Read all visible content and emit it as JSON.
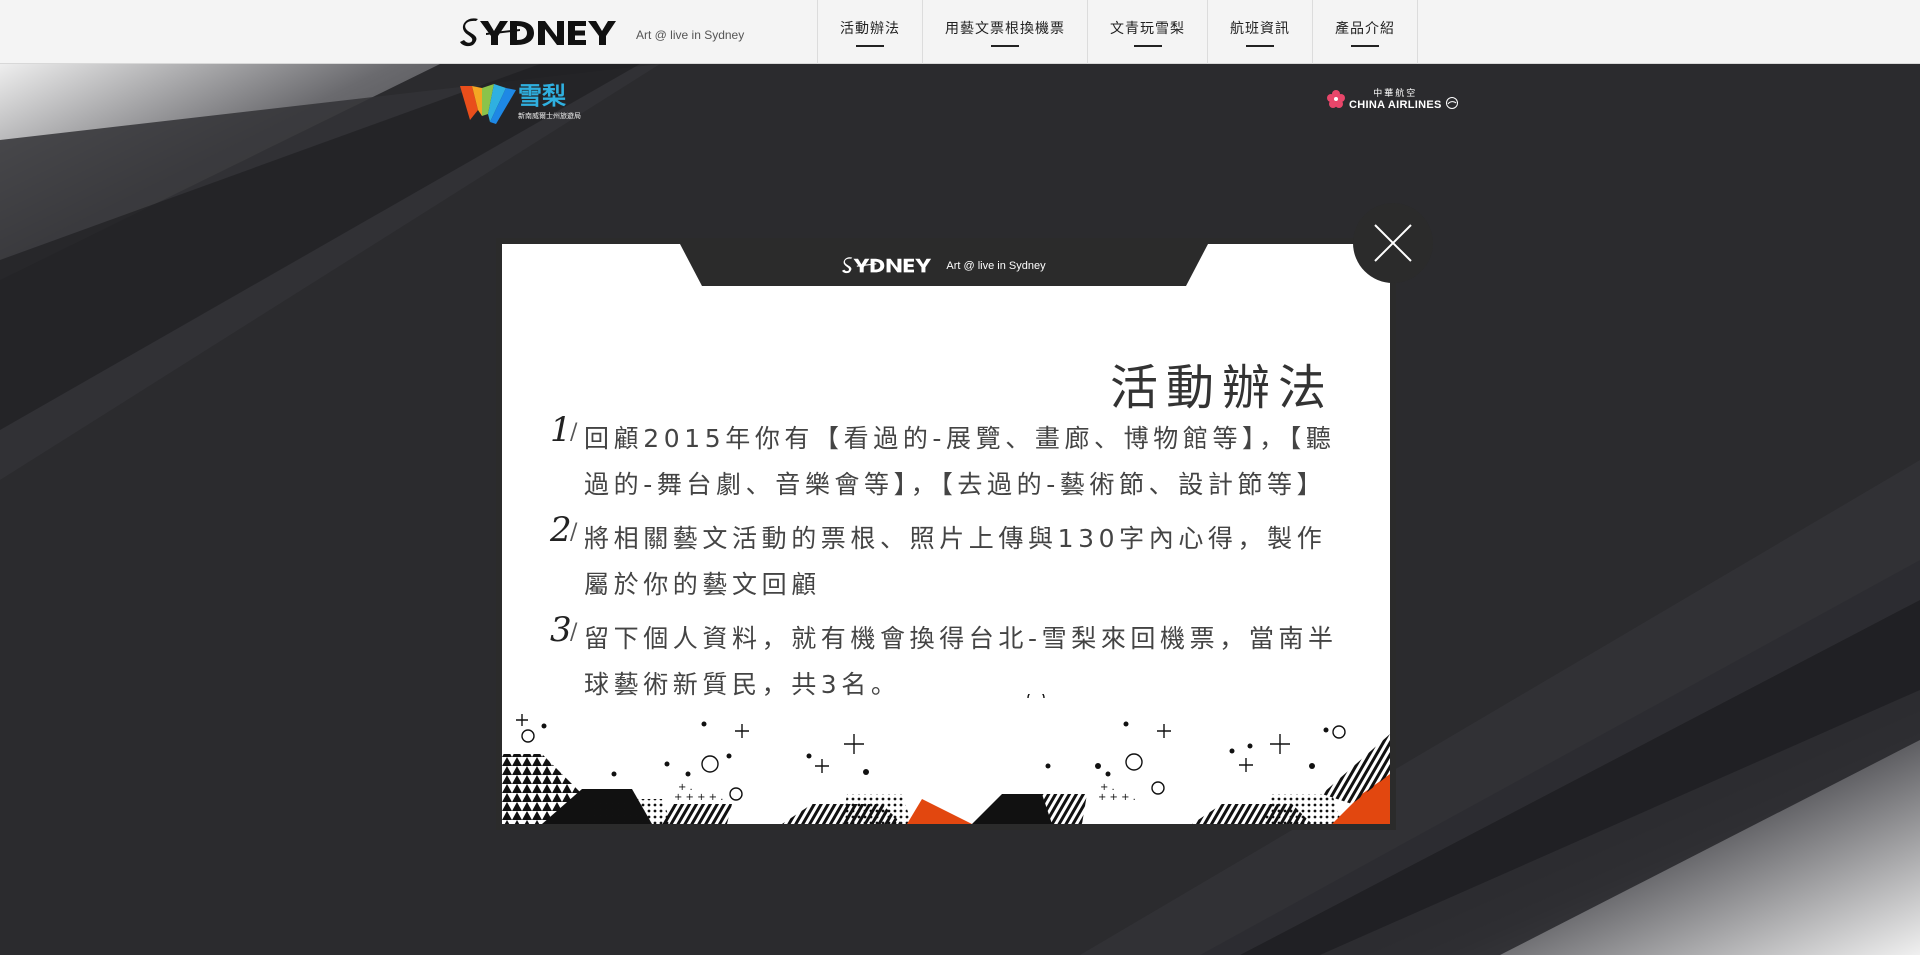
{
  "brand": {
    "logo_icon": "sydney-logo",
    "tagline": "Art @ live in Sydney"
  },
  "nav": {
    "items": [
      {
        "label": "活動辦法"
      },
      {
        "label": "用藝文票根換機票"
      },
      {
        "label": "文青玩雪梨"
      },
      {
        "label": "航班資訊"
      },
      {
        "label": "產品介紹"
      }
    ]
  },
  "partners": {
    "nsw": {
      "icon": "destination-nsw-logo",
      "title": "雪梨",
      "subtitle": "新南威爾士州旅遊局"
    },
    "china_airlines": {
      "icon": "china-airlines-logo",
      "top": "中華航空",
      "name": "CHINA AIRLINES"
    }
  },
  "modal": {
    "header_logo_icon": "sydney-logo",
    "header_tagline": "Art @ live in Sydney",
    "title": "活動辦法",
    "rules": [
      {
        "number": "1",
        "text": "回顧2015年你有【看過的-展覽、畫廊、博物館等】，【聽過的-舞台劇、音樂會等】，【去過的-藝術節、設計節等】"
      },
      {
        "number": "2",
        "text": "將相關藝文活動的票根、照片上傳與130字內心得，製作屬於你的藝文回顧"
      },
      {
        "number": "3",
        "text": "留下個人資料，就有機會換得台北-雪梨來回機票，當南半球藝術新質民，共3名。"
      }
    ],
    "close_icon": "close-icon"
  },
  "colors": {
    "background": "#2a2a2d",
    "topbar": "#f4f4f4",
    "accent_orange": "#e2470f",
    "nsw_blue": "#2fb0e0"
  }
}
